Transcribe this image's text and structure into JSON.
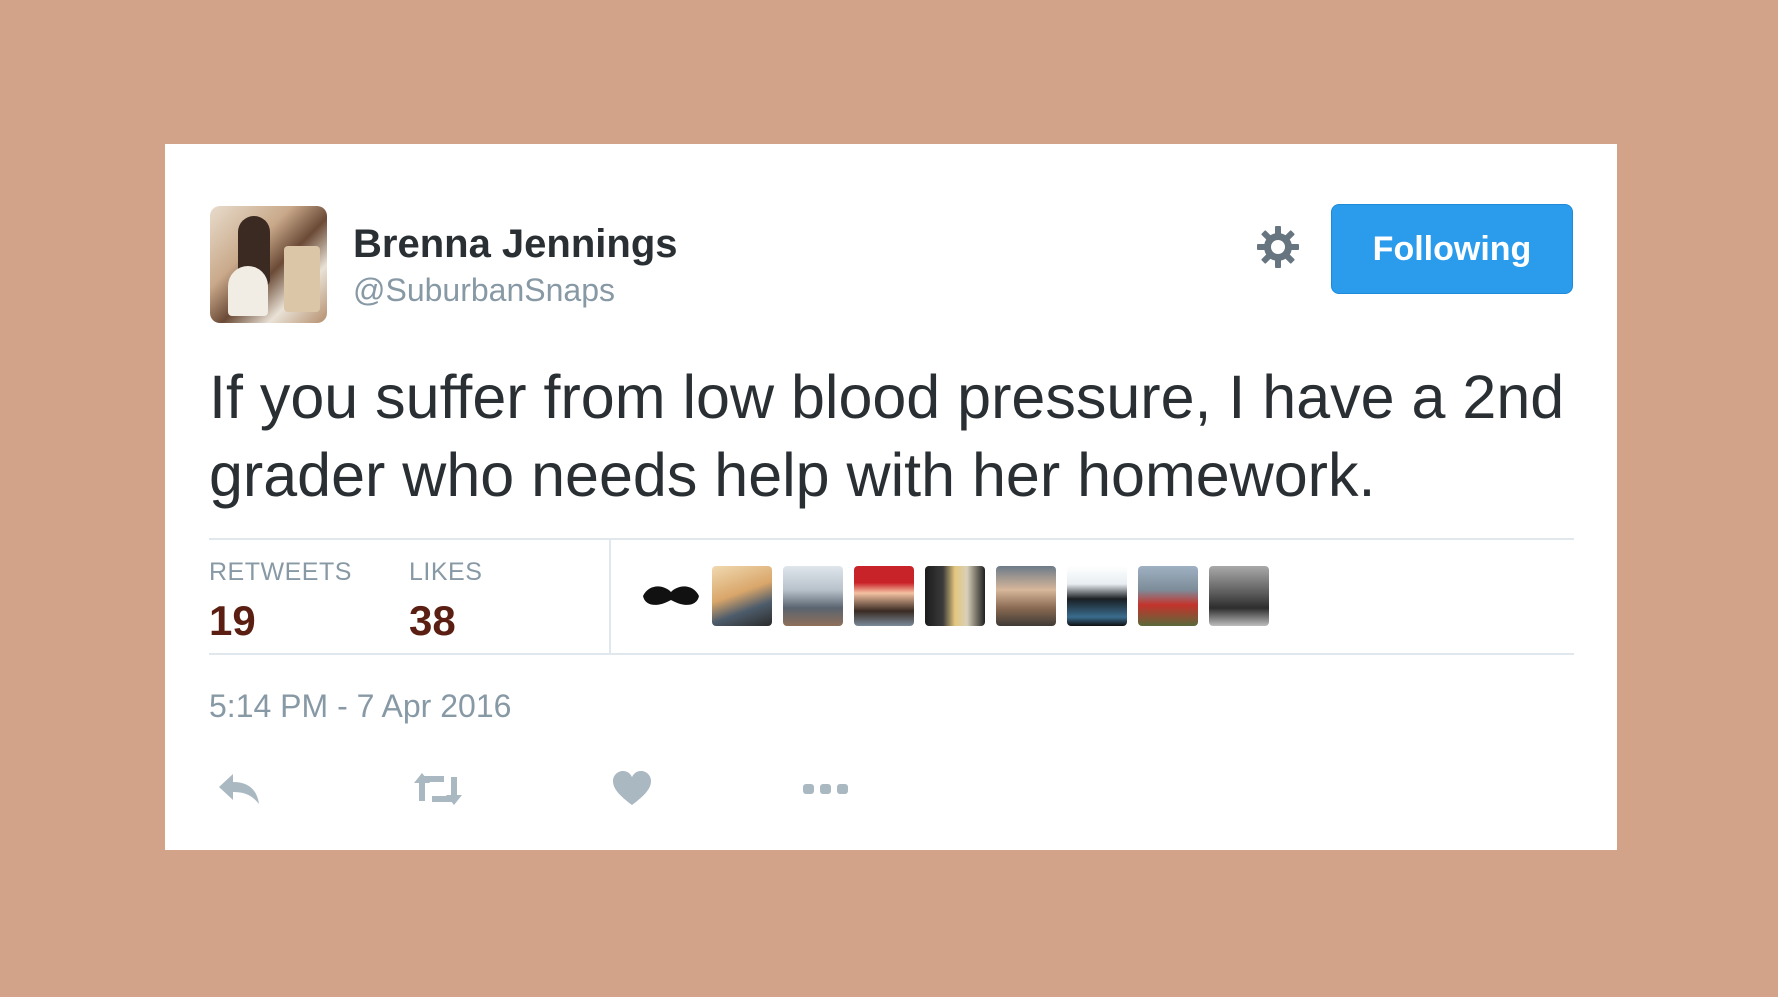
{
  "tweet": {
    "author": {
      "name": "Brenna Jennings",
      "handle": "@SuburbanSnaps"
    },
    "follow_button_label": "Following",
    "text": "If you suffer from low blood pressure, I have a 2nd grader who needs help with her homework.",
    "stats": {
      "retweets_label": "RETWEETS",
      "retweets_value": "19",
      "likes_label": "LIKES",
      "likes_value": "38"
    },
    "timestamp": "5:14 PM - 7 Apr 2016",
    "actions": [
      "reply-icon",
      "retweet-icon",
      "heart-icon",
      "more-icon"
    ]
  },
  "colors": {
    "background": "#d2a389",
    "card": "#ffffff",
    "accent": "#2b9bec",
    "stat_value": "#5a1f12",
    "muted": "#8899a6"
  }
}
